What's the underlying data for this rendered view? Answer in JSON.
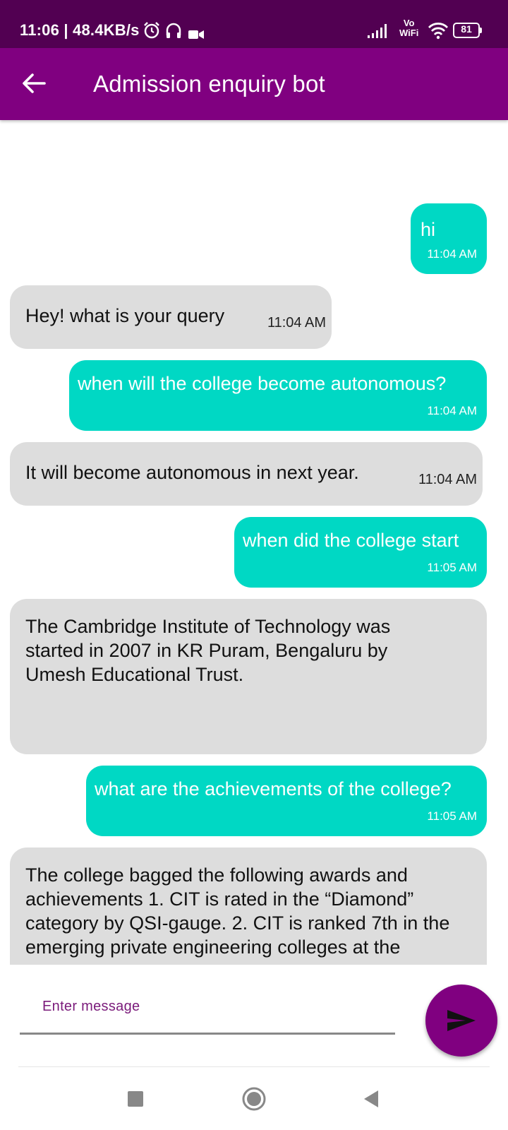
{
  "status_bar": {
    "time_speed": "11:06 | 48.4KB/s",
    "vowifi_top": "Vo",
    "vowifi_bottom": "WiFi",
    "battery_level": "81"
  },
  "app_bar": {
    "title": "Admission enquiry bot",
    "color": "#800080"
  },
  "messages": [
    {
      "sender": "user",
      "text": "hi",
      "time": "11:04 AM"
    },
    {
      "sender": "bot",
      "text": "Hey! what is your query",
      "time": "11:04 AM"
    },
    {
      "sender": "user",
      "text": "when will the college become autonomous?",
      "time": "11:04 AM"
    },
    {
      "sender": "bot",
      "text": "It will become autonomous in next year.",
      "time": "11:04 AM"
    },
    {
      "sender": "user",
      "text": "when did the college start",
      "time": "11:05 AM"
    },
    {
      "sender": "bot",
      "text": "The Cambridge Institute of Technology was started in 2007 in KR Puram, Bengaluru by Umesh Educational Trust.",
      "time": ""
    },
    {
      "sender": "user",
      "text": "what are the achievements of the college?",
      "time": "11:05 AM"
    },
    {
      "sender": "bot",
      "text": "The college bagged the following awards and achievements 1. CIT is rated in the “Diamond” category by QSI-gauge. 2. CIT is ranked 7th in the emerging private engineering colleges at the",
      "time": ""
    }
  ],
  "input": {
    "placeholder": "Enter message"
  },
  "colors": {
    "user_bubble": "#00d8c4",
    "bot_bubble": "#dddddd",
    "status_bar": "#520052"
  },
  "icons": {
    "back": "arrow-left-icon",
    "send": "send-icon",
    "nav_recent": "square-icon",
    "nav_home": "circle-icon",
    "nav_back": "triangle-back-icon"
  }
}
